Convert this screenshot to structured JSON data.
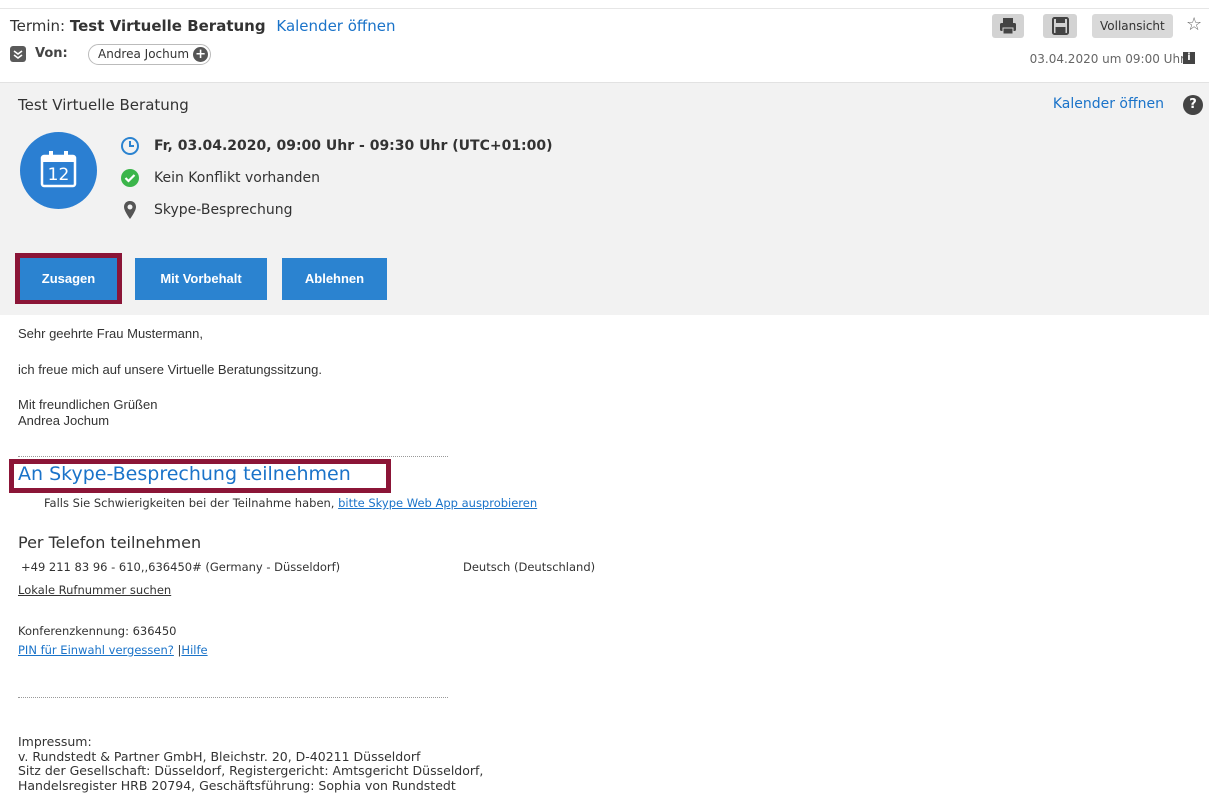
{
  "header": {
    "subject_prefix": "Termin:",
    "subject_title": "Test Virtuelle Beratung",
    "calendar_link": "Kalender öffnen",
    "from_label": "Von:",
    "sender_name": "Andrea Jochum",
    "full_view_label": "Vollansicht",
    "date": "03.04.2020 um 09:00 Uhr",
    "icons": [
      "print-icon",
      "save-icon",
      "star-icon",
      "info-icon",
      "sender-expand-icon",
      "add-contact-icon"
    ]
  },
  "invite": {
    "title": "Test Virtuelle Beratung",
    "calendar_link": "Kalender öffnen",
    "help_icon": "?",
    "calendar_day": "12",
    "time": "Fr, 03.04.2020, 09:00 Uhr - 09:30 Uhr (UTC+01:00)",
    "conflict": "Kein Konflikt vorhanden",
    "location": "Skype-Besprechung",
    "buttons": {
      "accept": "Zusagen",
      "tentative": "Mit Vorbehalt",
      "decline": "Ablehnen"
    },
    "colors": {
      "accent": "#2b83d0",
      "highlight": "#8b1537",
      "success": "#3bb54a"
    }
  },
  "body": {
    "greeting": "Sehr geehrte Frau Mustermann,",
    "line1": "ich freue mich auf unsere Virtuelle Beratungssitzung.",
    "closing": "Mit freundlichen Grüßen",
    "signature": "Andrea Jochum",
    "join_link": "An Skype-Besprechung teilnehmen",
    "trouble_text": "Falls Sie Schwierigkeiten bei der Teilnahme haben, ",
    "trouble_link": "bitte Skype Web App ausprobieren",
    "phone_title": "Per Telefon teilnehmen",
    "phone_number": "+49 211 83 96 - 610,,636450# (Germany - Düsseldorf)",
    "phone_lang": "Deutsch (Deutschland)",
    "local_numbers_link": "Lokale Rufnummer suchen",
    "conference_id": "Konferenzkennung: 636450",
    "pin_link": "PIN für Einwahl vergessen?",
    "separator": "|",
    "help_link": "Hilfe",
    "impressum": [
      "Impressum:",
      "v. Rundstedt & Partner GmbH, Bleichstr. 20, D-40211 Düsseldorf",
      "Sitz der Gesellschaft: Düsseldorf, Registergericht: Amtsgericht Düsseldorf,",
      "Handelsregister HRB 20794, Geschäftsführung: Sophia von Rundstedt"
    ]
  }
}
